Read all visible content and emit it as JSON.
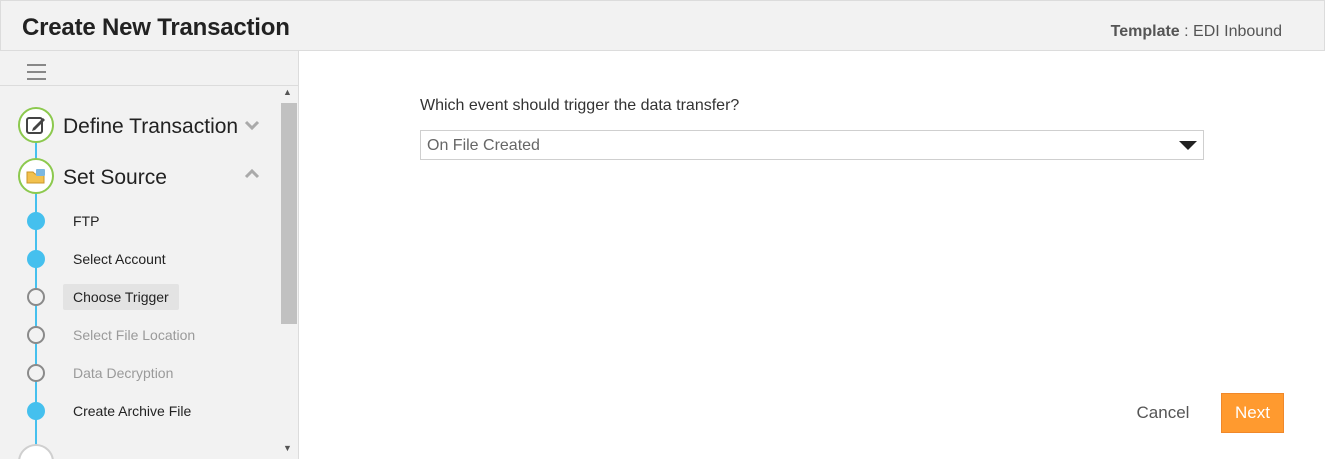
{
  "header": {
    "title": "Create New Transaction",
    "template_label": "Template",
    "template_sep": " : ",
    "template_value": "EDI Inbound"
  },
  "sidebar": {
    "menu_icon": "hamburger-icon",
    "steps": [
      {
        "label": "Define Transaction",
        "icon": "edit-icon",
        "chevron": "chevron-down-icon"
      },
      {
        "label": "Set Source",
        "icon": "folder-icon",
        "chevron": "chevron-up-icon"
      }
    ],
    "substeps": [
      {
        "label": "FTP",
        "state": "done"
      },
      {
        "label": "Select Account",
        "state": "done"
      },
      {
        "label": "Choose Trigger",
        "state": "current"
      },
      {
        "label": "Select File Location",
        "state": "pending"
      },
      {
        "label": "Data Decryption",
        "state": "pending"
      },
      {
        "label": "Create Archive File",
        "state": "done"
      }
    ]
  },
  "main": {
    "question": "Which event should trigger the data transfer?",
    "trigger_select": {
      "value": "On File Created"
    },
    "cancel_label": "Cancel",
    "next_label": "Next"
  },
  "colors": {
    "accent_blue": "#45c0ee",
    "step_green": "#8cc94e",
    "next_orange": "#ff9a2f"
  }
}
